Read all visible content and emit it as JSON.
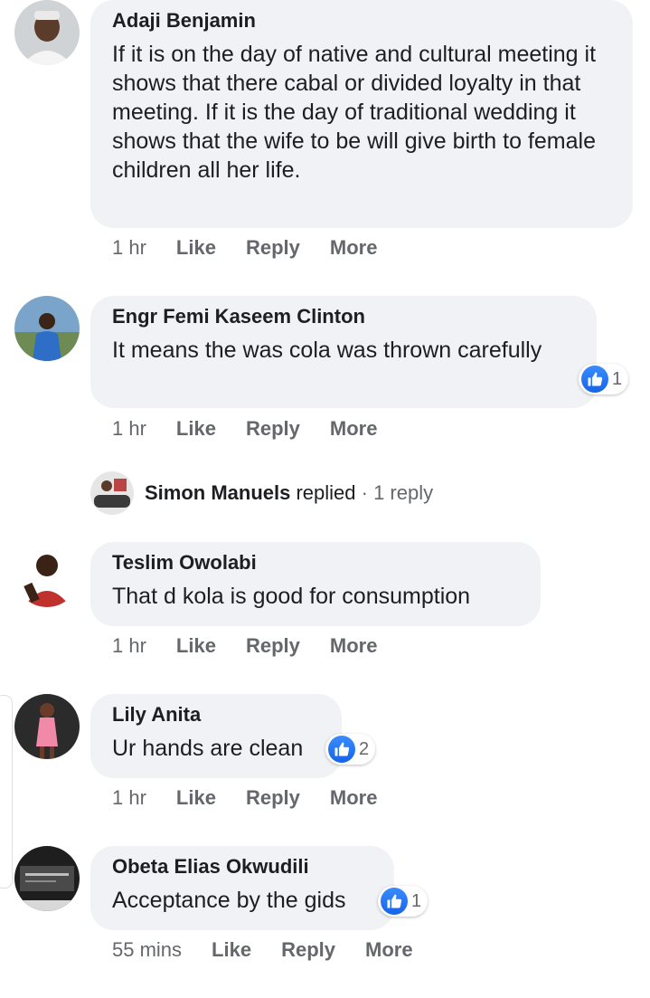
{
  "actions": {
    "like": "Like",
    "reply": "Reply",
    "more": "More"
  },
  "comments": [
    {
      "author": "Adaji Benjamin",
      "text": "If it is on the day of native and cultural meeting it shows that there cabal or divided loyalty in that meeting. If it is the day of traditional wedding it shows that the wife to be will give birth to female children all her life.",
      "time": "1 hr"
    },
    {
      "author": "Engr Femi Kaseem Clinton",
      "text": "It means the was cola was thrown carefully",
      "time": "1 hr",
      "reaction_count": "1"
    },
    {
      "author": "Teslim Owolabi",
      "text": "That d kola is good for consumption",
      "time": "1 hr"
    },
    {
      "author": "Lily Anita",
      "text": "Ur hands are clean",
      "time": "1 hr",
      "reaction_count": "2"
    },
    {
      "author": "Obeta Elias Okwudili",
      "text": "Acceptance by the gids",
      "time": "55 mins",
      "reaction_count": "1"
    }
  ],
  "reply_summary": {
    "name": "Simon Manuels",
    "verb": " replied",
    "separator": " · ",
    "count_text": "1 reply"
  },
  "icons": {
    "reaction": "like-icon"
  },
  "colors": {
    "bubble": "#f0f2f5",
    "like_blue": "#1877f2",
    "meta_gray": "#65676b"
  }
}
